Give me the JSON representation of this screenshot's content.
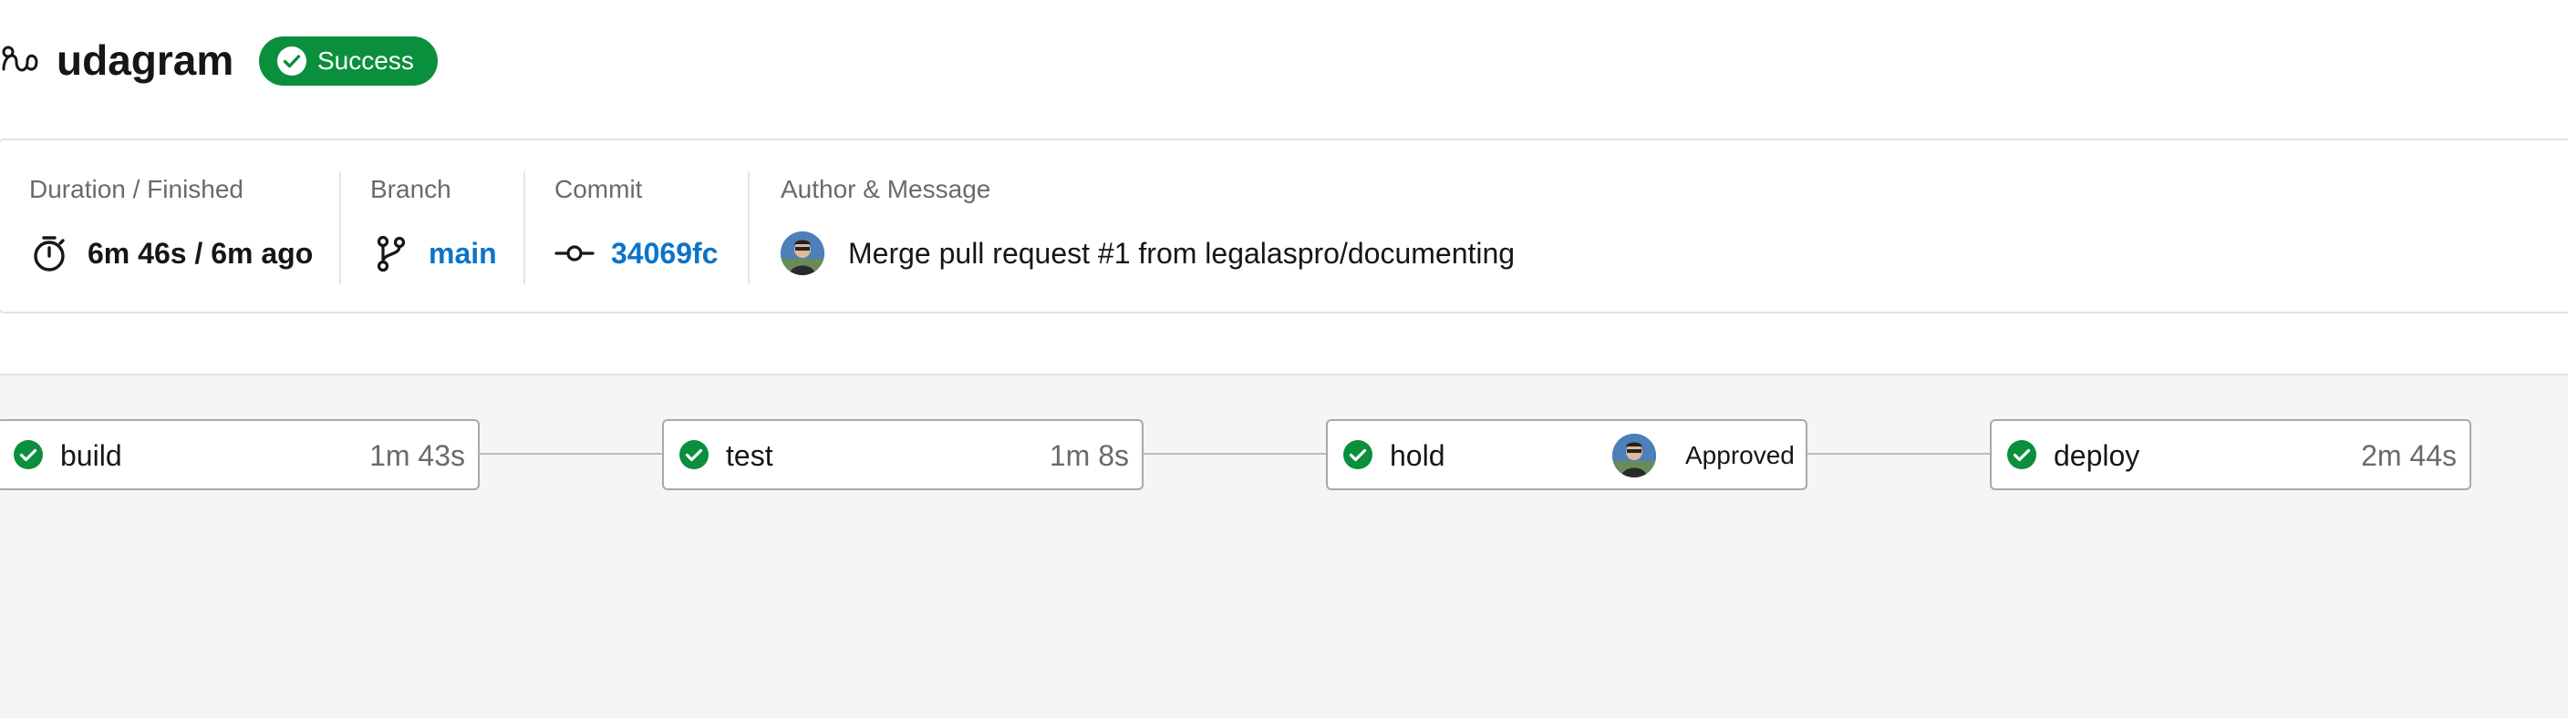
{
  "header": {
    "title": "udagram",
    "status": "Success",
    "status_color": "#0a8f3d"
  },
  "info": {
    "duration_label": "Duration / Finished",
    "duration_value": "6m 46s / 6m ago",
    "branch_label": "Branch",
    "branch_value": "main",
    "commit_label": "Commit",
    "commit_value": "34069fc",
    "author_label": "Author & Message",
    "message": "Merge pull request #1 from legalaspro/documenting",
    "link_color": "#0b74c9"
  },
  "jobs": [
    {
      "name": "build",
      "time": "1m 43s",
      "status_icon": "success-check"
    },
    {
      "name": "test",
      "time": "1m 8s",
      "status_icon": "success-check"
    },
    {
      "name": "hold",
      "status": "Approved",
      "status_icon": "success-check"
    },
    {
      "name": "deploy",
      "time": "2m 44s",
      "status_icon": "success-check"
    }
  ],
  "icons": {
    "workflow": "workflow-icon",
    "timer": "timer-icon",
    "branch": "branch-icon",
    "commit": "commit-icon"
  }
}
